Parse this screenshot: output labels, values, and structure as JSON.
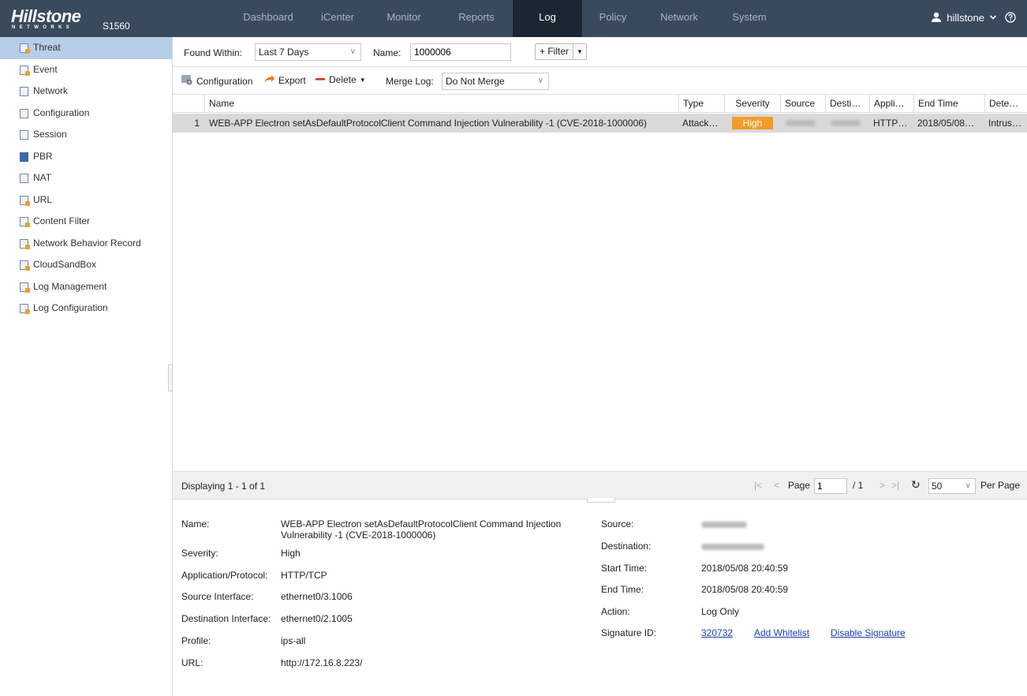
{
  "header": {
    "logo_text": "Hillstone",
    "logo_sub": "NETWORKS",
    "model": "S1560",
    "nav": [
      {
        "label": "Dashboard"
      },
      {
        "label": "iCenter"
      },
      {
        "label": "Monitor"
      },
      {
        "label": "Reports"
      },
      {
        "label": "Log"
      },
      {
        "label": "Policy"
      },
      {
        "label": "Network"
      },
      {
        "label": "System"
      }
    ],
    "active_nav": "Log",
    "user": "hillstone"
  },
  "sidebar": {
    "items": [
      {
        "label": "Threat",
        "icon": "threat-log-icon"
      },
      {
        "label": "Event",
        "icon": "event-log-icon"
      },
      {
        "label": "Network",
        "icon": "network-log-icon"
      },
      {
        "label": "Configuration",
        "icon": "configuration-log-icon"
      },
      {
        "label": "Session",
        "icon": "session-log-icon"
      },
      {
        "label": "PBR",
        "icon": "pbr-log-icon"
      },
      {
        "label": "NAT",
        "icon": "nat-log-icon"
      },
      {
        "label": "URL",
        "icon": "url-log-icon"
      },
      {
        "label": "Content Filter",
        "icon": "content-filter-icon"
      },
      {
        "label": "Network Behavior Record",
        "icon": "behavior-record-icon"
      },
      {
        "label": "CloudSandBox",
        "icon": "cloudsandbox-icon"
      },
      {
        "label": "Log Management",
        "icon": "log-management-icon"
      },
      {
        "label": "Log Configuration",
        "icon": "log-configuration-icon"
      }
    ],
    "active": "Threat"
  },
  "filter": {
    "found_within_label": "Found Within:",
    "found_within_value": "Last 7 Days",
    "name_label": "Name:",
    "name_value": "1000006",
    "filter_button": "+ Filter"
  },
  "toolbar": {
    "configuration": "Configuration",
    "export": "Export",
    "delete": "Delete",
    "merge_label": "Merge Log:",
    "merge_value": "Do Not Merge"
  },
  "grid": {
    "columns": [
      "Name",
      "Type",
      "Severity",
      "Source",
      "Desti…",
      "Appli…",
      "End Time",
      "Dete…"
    ],
    "rows": [
      {
        "index": "1",
        "name": "WEB-APP Electron setAsDefaultProtocolClient Command Injection Vulnerability -1 (CVE-2018-1000006)",
        "type": "Attack…",
        "severity": "High",
        "application": "HTTP…",
        "end_time": "2018/05/08…",
        "detection": "Intrus…"
      }
    ]
  },
  "pager": {
    "displaying": "Displaying 1 - 1 of 1",
    "page_label": "Page",
    "page_value": "1",
    "total": "/ 1",
    "per_page_value": "50",
    "per_page_label": "Per Page"
  },
  "detail": {
    "name_label": "Name:",
    "name_value_line1": "WEB-APP Electron setAsDefaultProtocolClient Command Injection",
    "name_value_line2": "Vulnerability -1 (CVE-2018-1000006)",
    "severity_label": "Severity:",
    "severity_value": "High",
    "app_label": "Application/Protocol:",
    "app_value": "HTTP/TCP",
    "src_if_label": "Source Interface:",
    "src_if_value": "ethernet0/3.1006",
    "dst_if_label": "Destination Interface:",
    "dst_if_value": "ethernet0/2.1005",
    "profile_label": "Profile:",
    "profile_value": "ips-all",
    "url_label": "URL:",
    "url_value": "http://172.16.8.223/",
    "source_label": "Source:",
    "destination_label": "Destination:",
    "start_label": "Start Time:",
    "start_value": "2018/05/08 20:40:59",
    "end_label": "End Time:",
    "end_value": "2018/05/08 20:40:59",
    "action_label": "Action:",
    "action_value": "Log Only",
    "sig_label": "Signature ID:",
    "sig_value": "320732",
    "add_whitelist": "Add Whitelist",
    "disable_signature": "Disable Signature"
  },
  "colors": {
    "topbar": "#394a5d",
    "nav_active": "#1b2633",
    "sidebar_active": "#b8cde8",
    "severity_high": "#f39c2a",
    "link": "#1a3fb3"
  }
}
